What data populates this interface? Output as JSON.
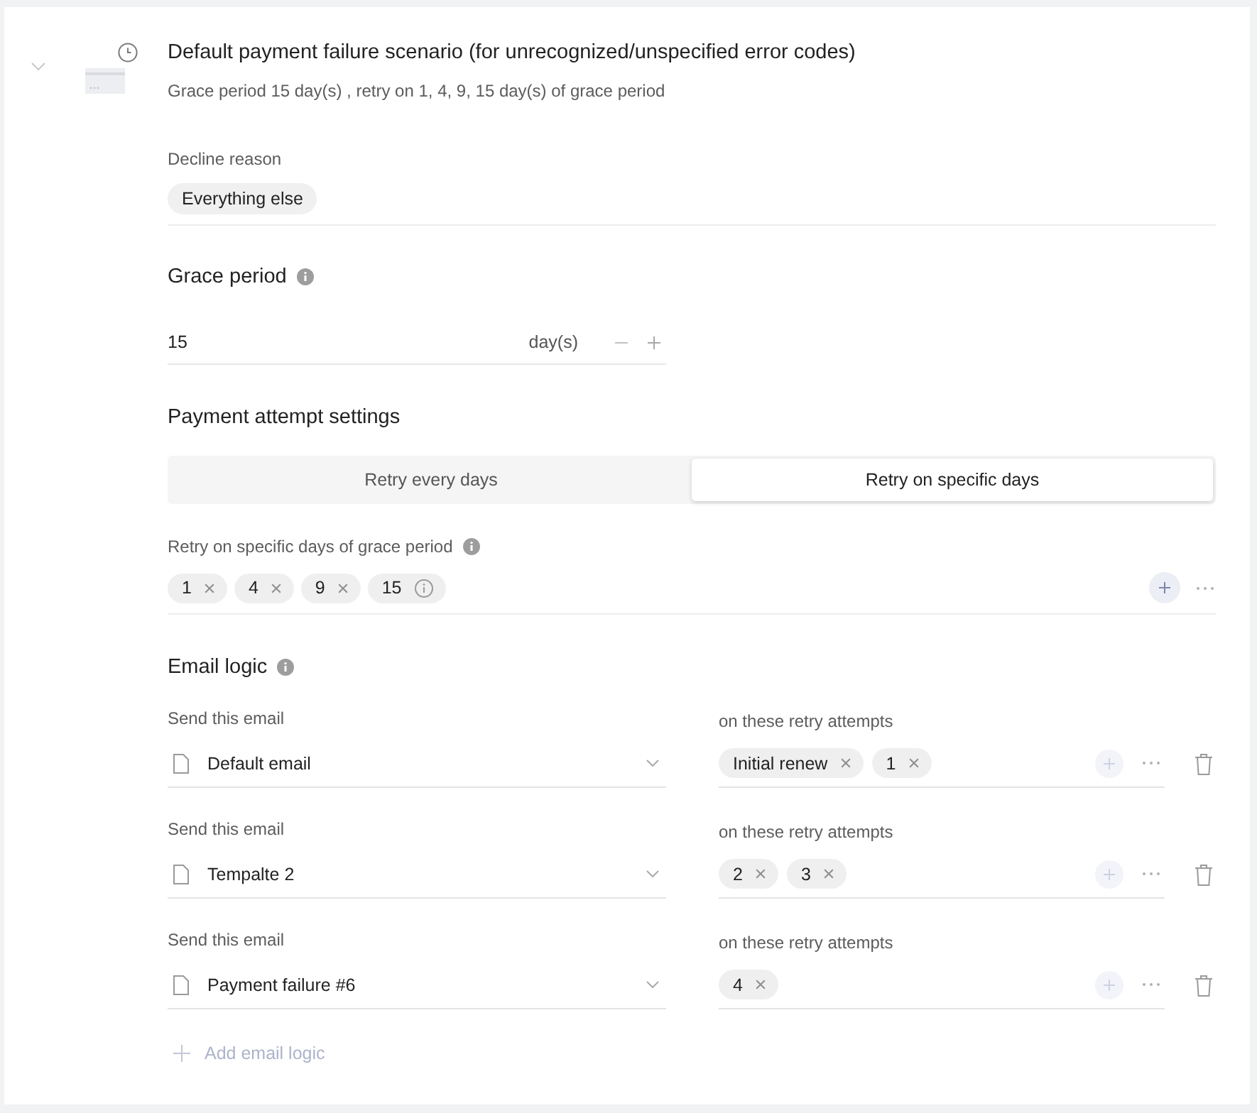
{
  "scenario": {
    "expanded": true,
    "title": "Default payment failure scenario (for unrecognized/unspecified error codes)",
    "summary": "Grace period 15 day(s) , retry on 1, 4, 9, 15 day(s) of grace period"
  },
  "decline_reason": {
    "label": "Decline reason",
    "chips": [
      "Everything else"
    ]
  },
  "grace_period": {
    "title": "Grace period",
    "value": "15",
    "unit": "day(s)"
  },
  "payment_attempts": {
    "title": "Payment attempt settings",
    "tabs": [
      {
        "label": "Retry every days",
        "selected": false
      },
      {
        "label": "Retry on specific days",
        "selected": true
      }
    ],
    "days_label": "Retry on specific days of grace period",
    "days": [
      {
        "label": "1",
        "kind": "removable"
      },
      {
        "label": "4",
        "kind": "removable"
      },
      {
        "label": "9",
        "kind": "removable"
      },
      {
        "label": "15",
        "kind": "info"
      }
    ],
    "add_disabled": false
  },
  "email_logic": {
    "title": "Email logic",
    "rules": [
      {
        "email_label": "Send this email",
        "email": "Default email",
        "attempts_label": "on these retry attempts",
        "attempts": [
          "Initial renew",
          "1"
        ],
        "add_disabled": true
      },
      {
        "email_label": "Send this email",
        "email": "Tempalte 2",
        "attempts_label": "on these retry attempts",
        "attempts": [
          "2",
          "3"
        ],
        "add_disabled": true
      },
      {
        "email_label": "Send this email",
        "email": "Payment failure #6",
        "attempts_label": "on these retry attempts",
        "attempts": [
          "4"
        ],
        "add_disabled": true
      }
    ],
    "add_label": "Add email logic"
  }
}
